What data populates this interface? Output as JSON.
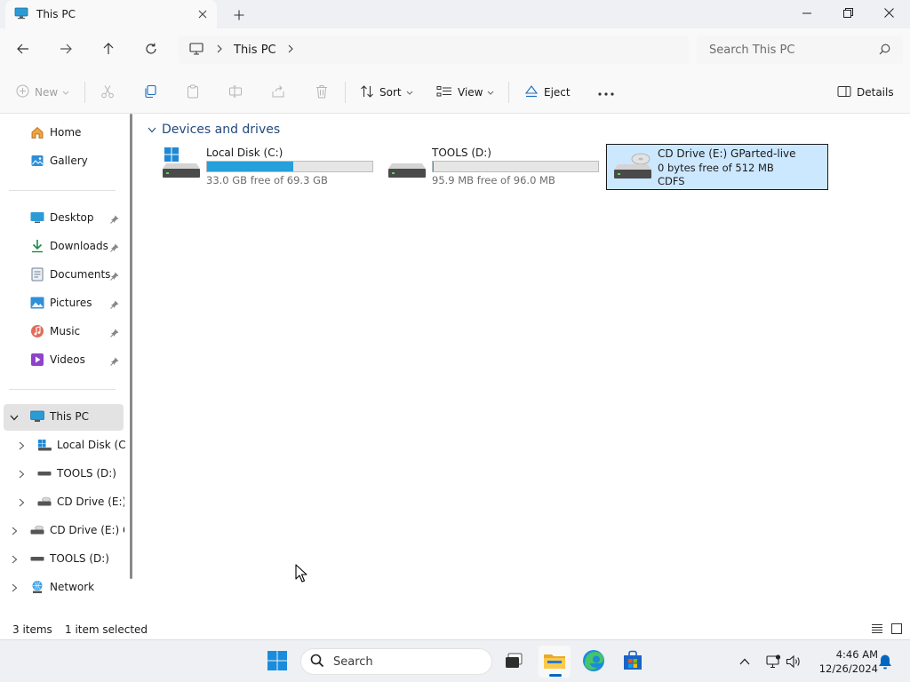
{
  "window": {
    "tab_title": "This PC",
    "icons": {
      "tab": "this-pc-icon",
      "new_tab": "plus-icon",
      "minimize": "minimize-icon",
      "maximize": "restore-icon",
      "close": "close-icon"
    }
  },
  "navigation": {
    "breadcrumb": [
      "This PC"
    ],
    "search_placeholder": "Search This PC"
  },
  "command_bar": {
    "new_label": "New",
    "sort_label": "Sort",
    "view_label": "View",
    "eject_label": "Eject",
    "details_label": "Details",
    "disabled": [
      "new",
      "cut",
      "paste",
      "rename",
      "share",
      "delete"
    ]
  },
  "sidebar": {
    "top_items": [
      {
        "label": "Home",
        "icon": "home-icon"
      },
      {
        "label": "Gallery",
        "icon": "gallery-icon"
      }
    ],
    "quick_access": [
      {
        "label": "Desktop",
        "icon": "desktop-icon",
        "pinned": true
      },
      {
        "label": "Downloads",
        "icon": "downloads-icon",
        "pinned": true
      },
      {
        "label": "Documents",
        "icon": "documents-icon",
        "pinned": true
      },
      {
        "label": "Pictures",
        "icon": "pictures-icon",
        "pinned": true
      },
      {
        "label": "Music",
        "icon": "music-icon",
        "pinned": true
      },
      {
        "label": "Videos",
        "icon": "videos-icon",
        "pinned": true
      }
    ],
    "tree": [
      {
        "label": "This PC",
        "icon": "this-pc-icon",
        "expanded": true,
        "selected": true
      },
      {
        "label": "Local Disk (C:)",
        "icon": "windows-drive-icon",
        "level": 1
      },
      {
        "label": "TOOLS (D:)",
        "icon": "drive-icon",
        "level": 1
      },
      {
        "label": "CD Drive (E:) G",
        "icon": "cd-drive-icon",
        "level": 1
      },
      {
        "label": "CD Drive (E:) GP",
        "icon": "cd-drive-icon",
        "level": 0
      },
      {
        "label": "TOOLS (D:)",
        "icon": "drive-icon",
        "level": 0
      },
      {
        "label": "Network",
        "icon": "network-icon",
        "level": 0
      }
    ]
  },
  "content": {
    "group_label": "Devices and drives",
    "drives": [
      {
        "name": "Local Disk (C:)",
        "free_text": "33.0 GB free of 69.3 GB",
        "used_fraction": 0.524,
        "icon": "windows-drive-icon",
        "selected": false
      },
      {
        "name": "TOOLS (D:)",
        "free_text": "95.9 MB free of 96.0 MB",
        "used_fraction": 0.001,
        "icon": "drive-icon",
        "selected": false
      },
      {
        "name": "CD Drive (E:) GParted-live",
        "line2": "0 bytes free of 512 MB",
        "line3": "CDFS",
        "icon": "cd-drive-icon",
        "selected": true
      }
    ]
  },
  "status_bar": {
    "item_count": "3 items",
    "selection": "1 item selected"
  },
  "taskbar": {
    "search_label": "Search",
    "apps": [
      "start-icon",
      "task-view-icon",
      "file-explorer-icon",
      "edge-icon",
      "store-icon"
    ],
    "time": "4:46 AM",
    "date": "12/26/2024"
  },
  "colors": {
    "accent": "#0067c0",
    "selection_bg": "#cce8ff",
    "usage_bar": "#26a0da"
  }
}
